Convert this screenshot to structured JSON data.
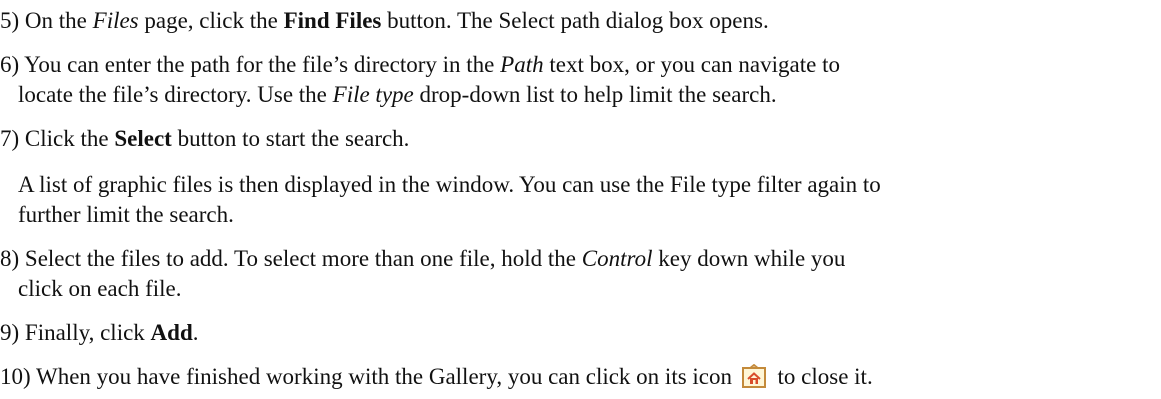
{
  "steps": {
    "s5": {
      "num": "5)",
      "a": "On the",
      "b": "Files",
      "c": "page, click the",
      "d": "Find Files",
      "e": "button. The Select path dialog box opens."
    },
    "s6": {
      "num": "6)",
      "a": "You can enter the path for the file’s directory in the",
      "b": "Path",
      "c": "text box, or you can navigate to",
      "line2a": "locate the file’s directory. Use the",
      "line2b": "File type",
      "line2c": "drop-down list to help limit the search."
    },
    "s7": {
      "num": "7)",
      "a": "Click the",
      "b": "Select",
      "c": "button to start the search.",
      "para1": "A list of graphic files is then displayed in the window. You can use the File type filter again to",
      "para2": "further limit the search."
    },
    "s8": {
      "num": "8)",
      "a": "Select the files to add. To select more than one file, hold the",
      "b": "Control",
      "c": "key down while you",
      "line2": "click on each file."
    },
    "s9": {
      "num": "9)",
      "a": "Finally, click",
      "b": "Add",
      "c": "."
    },
    "s10": {
      "num": "10)",
      "a": "When you have finished working with the Gallery, you can click on its icon",
      "b": "to close it."
    }
  },
  "icons": {
    "gallery": "gallery-icon"
  },
  "colors": {
    "text": "#111111",
    "icon_frame": "#c48a3a",
    "icon_bg": "#fff6d6",
    "icon_house": "#d94c2a"
  }
}
